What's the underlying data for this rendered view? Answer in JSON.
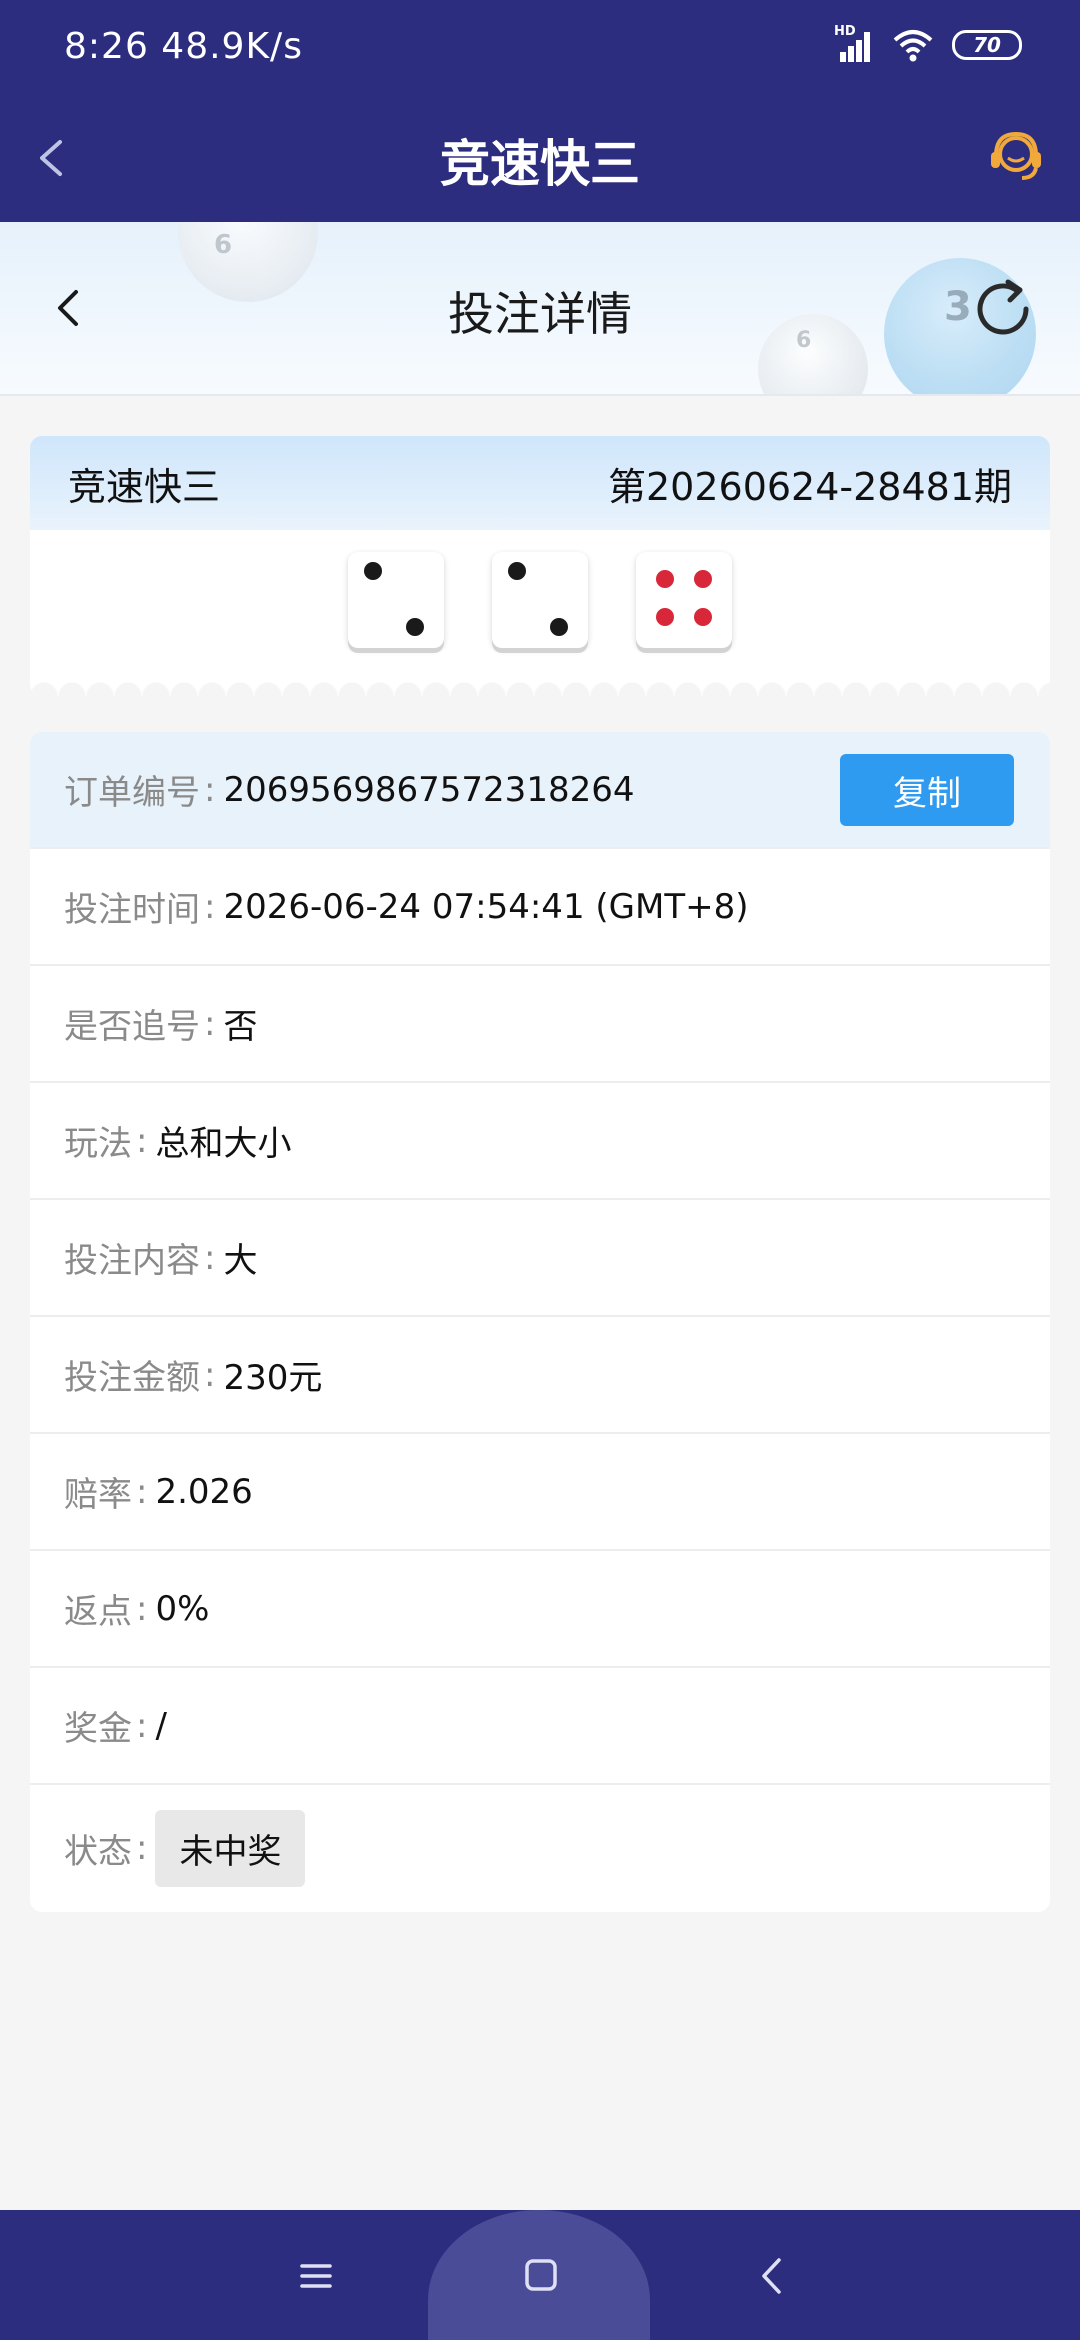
{
  "status_bar": {
    "time": "8:26",
    "speed": "48.9K/s",
    "network": "HD",
    "battery": "70"
  },
  "app_header": {
    "title": "竞速快三"
  },
  "sub_header": {
    "title": "投注详情",
    "ball_numbers": [
      "6",
      "6",
      "3"
    ]
  },
  "draw": {
    "game_name": "竞速快三",
    "period": "第20260624-28481期",
    "dice": [
      2,
      2,
      4
    ]
  },
  "details": {
    "order_no": {
      "label": "订单编号",
      "value": "2069569867572318264"
    },
    "copy_label": "复制",
    "bet_time": {
      "label": "投注时间",
      "value": "2026-06-24 07:54:41 (GMT+8)"
    },
    "chase": {
      "label": "是否追号",
      "value": "否"
    },
    "play_type": {
      "label": "玩法",
      "value": "总和大小"
    },
    "bet_content": {
      "label": "投注内容",
      "value": "大"
    },
    "bet_amount": {
      "label": "投注金额",
      "value": "230元"
    },
    "odds": {
      "label": "赔率",
      "value": "2.026"
    },
    "rebate": {
      "label": "返点",
      "value": "0%"
    },
    "bonus": {
      "label": "奖金",
      "value": "/"
    },
    "status": {
      "label": "状态",
      "value": "未中奖"
    }
  },
  "colors": {
    "header_bg": "#2c2d7e",
    "copy_button": "#2f9bf0",
    "support_icon": "#f2a93b",
    "red_pip": "#d9273a"
  }
}
